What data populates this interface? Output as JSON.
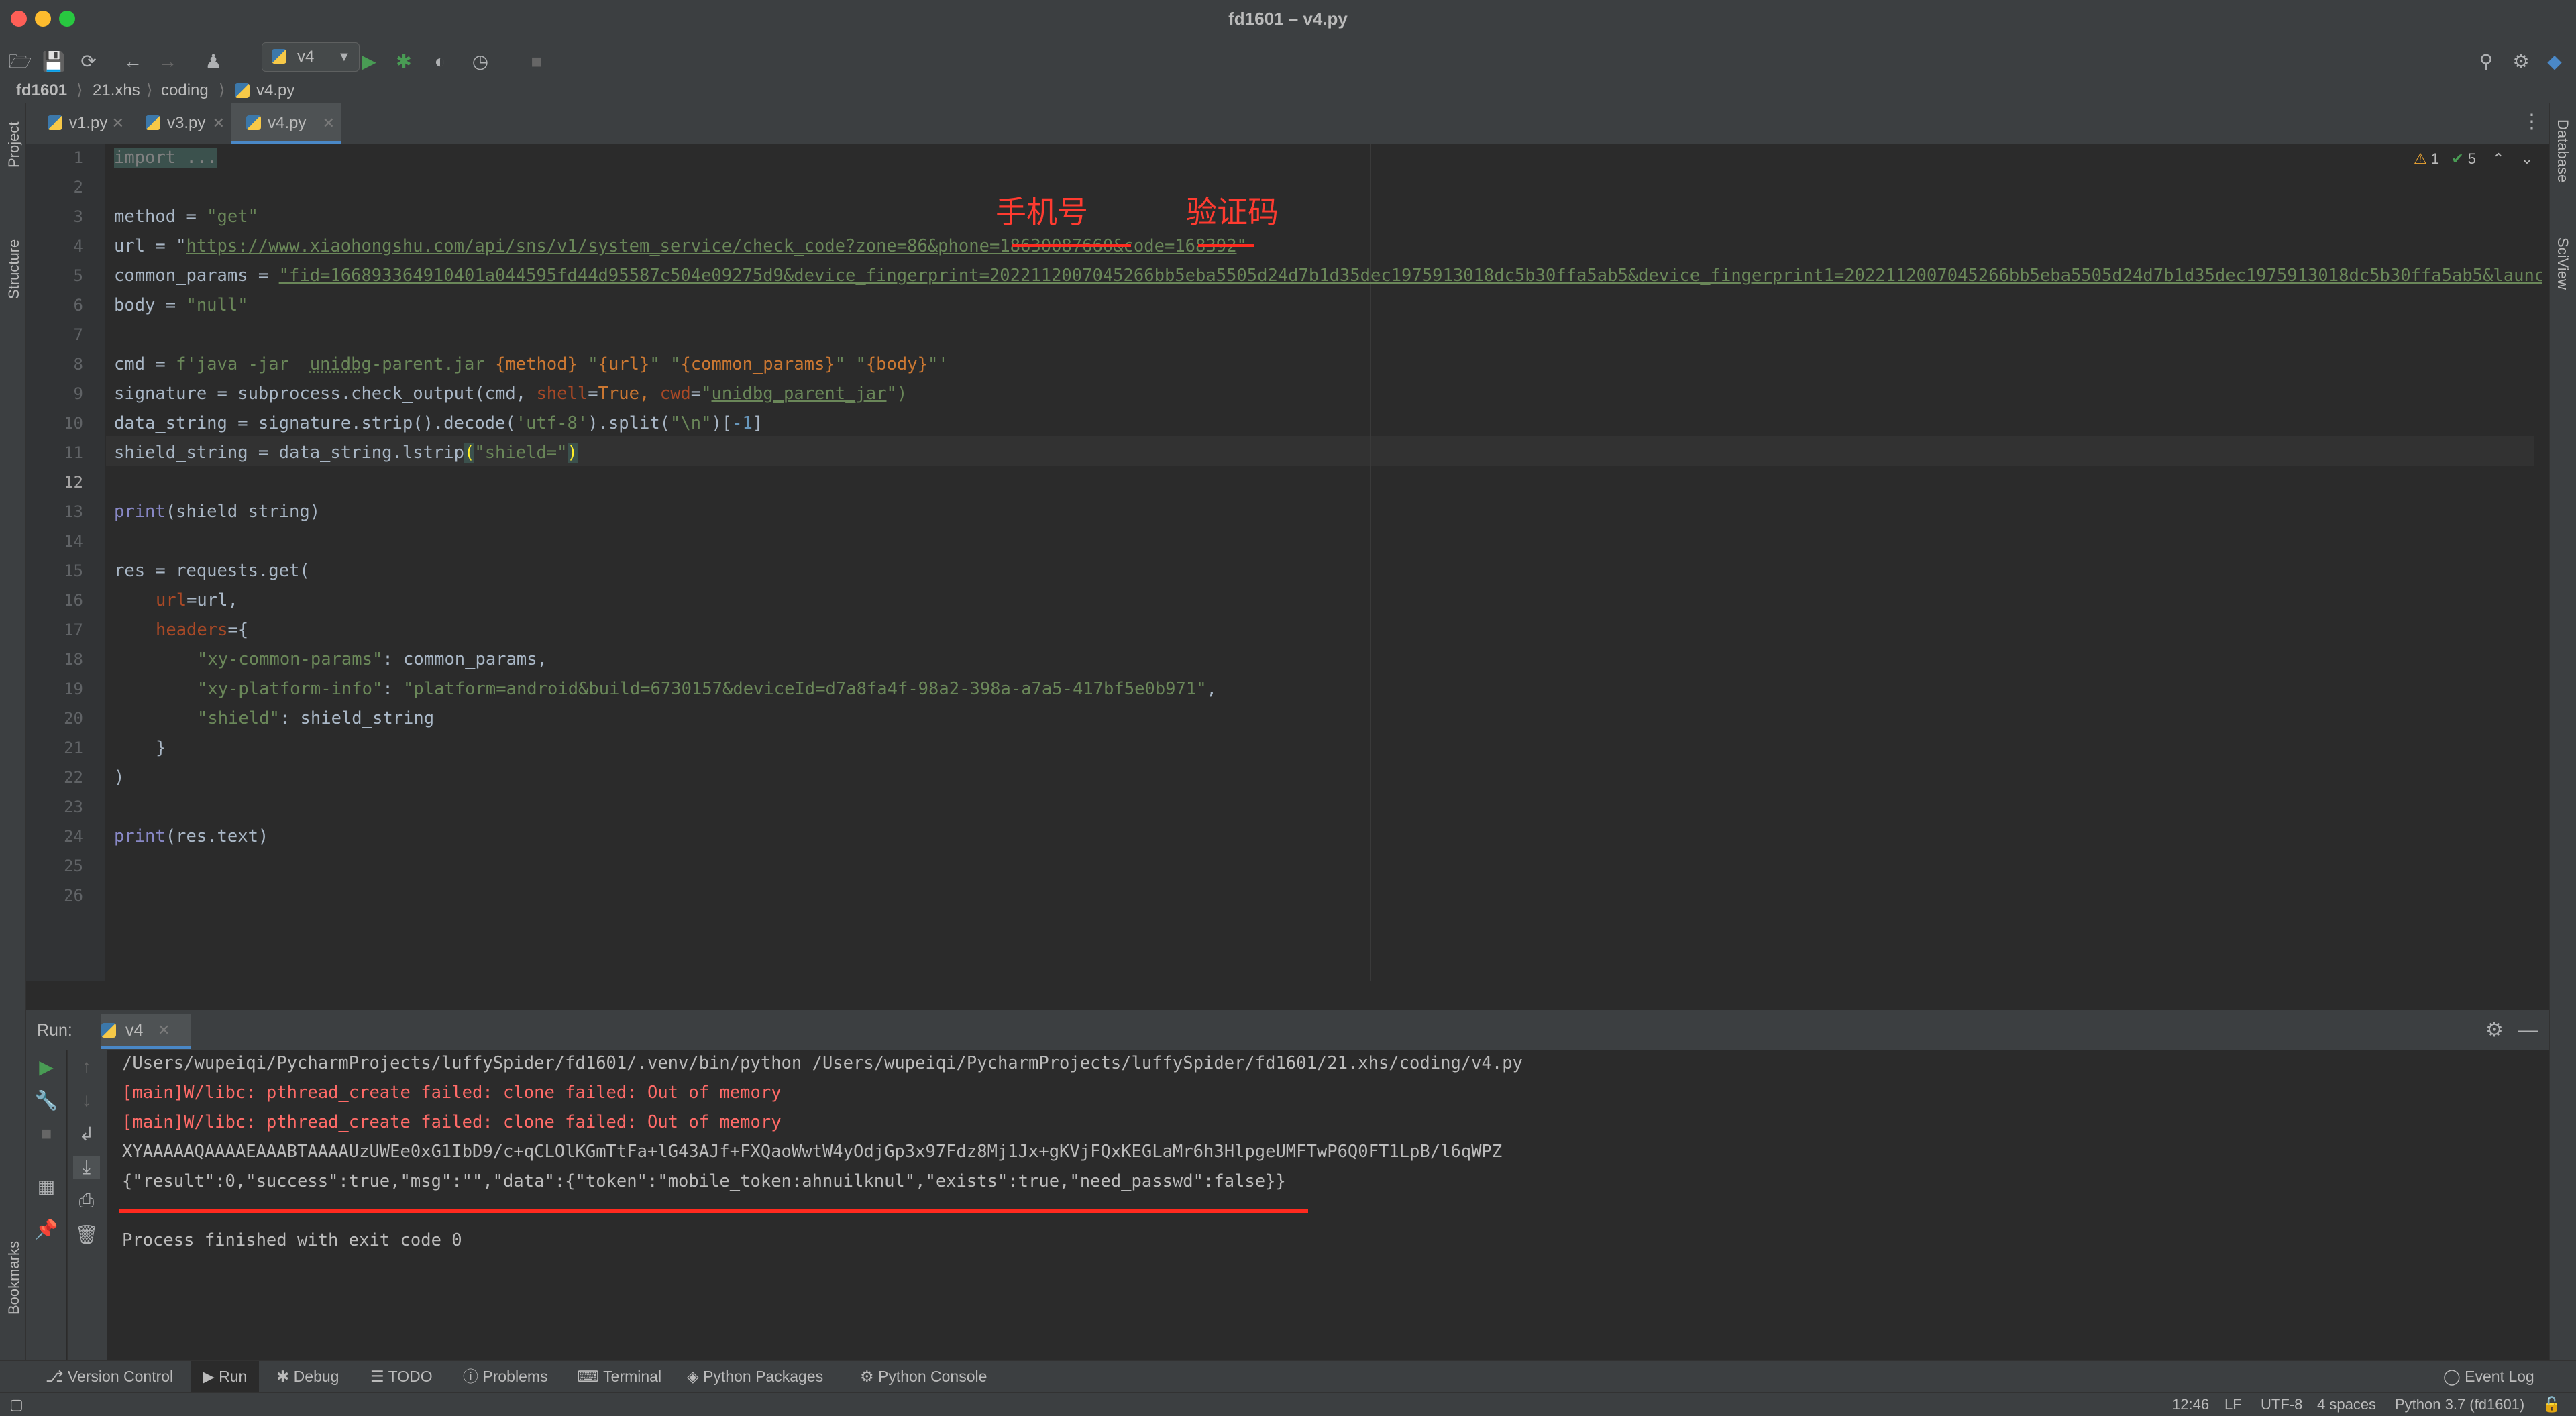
{
  "window": {
    "title": "fd1601 – v4.py"
  },
  "toolbar": {
    "run_config": "v4"
  },
  "breadcrumb": [
    "fd1601",
    "21.xhs",
    "coding",
    "v4.py"
  ],
  "side_tools": {
    "project": "Project",
    "structure": "Structure",
    "bookmarks": "Bookmarks",
    "database": "Database",
    "sciview": "SciView"
  },
  "tabs": [
    {
      "label": "v1.py",
      "active": false
    },
    {
      "label": "v3.py",
      "active": false
    },
    {
      "label": "v4.py",
      "active": true
    }
  ],
  "inspections": {
    "warnings": "1",
    "ok": "5"
  },
  "annotations": {
    "phone_label": "手机号",
    "code_label": "验证码"
  },
  "code": {
    "line_numbers": [
      "1",
      "2",
      "3",
      "4",
      "5",
      "6",
      "7",
      "8",
      "9",
      "10",
      "11",
      "12",
      "13",
      "14",
      "15",
      "16",
      "17",
      "18",
      "19",
      "20",
      "21",
      "22",
      "23",
      "24",
      "25",
      "26"
    ],
    "import": "import ...",
    "method_lhs": "method = ",
    "method_val": "\"get\"",
    "url_lhs": "url = \"",
    "url_val": "https://www.xiaohongshu.com/api/sns/v1/system_service/check_code?zone=86&phone=",
    "url_phone": "18630087660",
    "url_mid": "&code=",
    "url_code": "168392",
    "url_end": "\"",
    "cp_lhs": "common_params = ",
    "cp_val": "\"fid=166893364910401a044595fd44d95587c504e09275d9&device_fingerprint=2022112007045266bb5eba5505d24d7b1d35dec1975913018dc5b30ffa5ab5&device_fingerprint1=2022112007045266bb5eba5505d24d7b1d35dec1975913018dc5b30ffa5ab5&launc",
    "body_lhs": "body = ",
    "body_val": "\"null\"",
    "cmd_lhs": "cmd = ",
    "cmd_f": "f'java -jar  ",
    "cmd_jar": "unidbg",
    "cmd_jar2": "-parent.jar ",
    "cmd_m": "{method}",
    "cmd_s1": " \"",
    "cmd_u": "{url}",
    "cmd_s2": "\" \"",
    "cmd_c": "{common_params}",
    "cmd_s3": "\" \"",
    "cmd_b": "{body}",
    "cmd_end": "\"'",
    "sig_1": "signature = subprocess.check_output(cmd, ",
    "sig_shell": "shell",
    "sig_eq": "=",
    "sig_true": "True",
    "sig_comma": ", ",
    "sig_cwd": "cwd",
    "sig_eq2": "=",
    "sig_cwdval_q": "\"",
    "sig_cwdval": "unidbg_parent_jar",
    "sig_cwdend": "\")",
    "ds_1": "data_string = signature.strip().decode(",
    "ds_utf": "'utf-8'",
    "ds_2": ").split(",
    "ds_nl": "\"\\n\"",
    "ds_3": ")[",
    "ds_idx": "-1",
    "ds_4": "]",
    "sh_1": "shield_string = data_string.lstrip",
    "sh_p1": "(",
    "sh_arg": "\"shield=\"",
    "sh_p2": ")",
    "print1_fn": "print",
    "print1_arg": "(shield_string)",
    "res_1": "res = requests.get(",
    "url_kw": "url",
    "url_kwv": "=url,",
    "headers_kw": "headers",
    "headers_v": "={",
    "h1_k": "\"xy-common-params\"",
    "h1_v": ": common_params,",
    "h2_k": "\"xy-platform-info\"",
    "h2_sep": ": ",
    "h2_v": "\"platform=android&build=6730157&deviceId=d7a8fa4f-98a2-398a-a7a5-417bf5e0b971\"",
    "h2_end": ",",
    "h3_k": "\"shield\"",
    "h3_v": ": shield_string",
    "close_brace": "}",
    "close_paren": ")",
    "print2_fn": "print",
    "print2_arg": "(res.text)"
  },
  "run": {
    "label": "Run:",
    "tab": "v4",
    "output": [
      "/Users/wupeiqi/PycharmProjects/luffySpider/fd1601/.venv/bin/python /Users/wupeiqi/PycharmProjects/luffySpider/fd1601/21.xhs/coding/v4.py",
      "[main]W/libc: pthread_create failed: clone failed: Out of memory",
      "[main]W/libc: pthread_create failed: clone failed: Out of memory",
      "XYAAAAAQAAAAEAAABTAAAAUzUWEe0xG1IbD9/c+qCLOlKGmTtFa+lG43AJf+FXQaoWwtW4yOdjGp3x97Fdz8Mj1Jx+gKVjFQxKEGLaMr6h3HlpgeUMFTwP6Q0FT1LpB/l6qWPZ",
      "{\"result\":0,\"success\":true,\"msg\":\"\",\"data\":{\"token\":\"mobile_token:ahnuilknul\",\"exists\":true,\"need_passwd\":false}}",
      "Process finished with exit code 0"
    ]
  },
  "bottom_tools": [
    "Version Control",
    "Run",
    "Debug",
    "TODO",
    "Problems",
    "Terminal",
    "Python Packages",
    "Python Console",
    "Event Log"
  ],
  "status": {
    "pos": "12:46",
    "lf": "LF",
    "enc": "UTF-8",
    "indent": "4 spaces",
    "interpreter": "Python 3.7 (fd1601)"
  },
  "colors": {
    "accent": "#4a88c7",
    "error": "#ff6b68",
    "annotation": "#ff2a1f",
    "run_green": "#499c54"
  }
}
